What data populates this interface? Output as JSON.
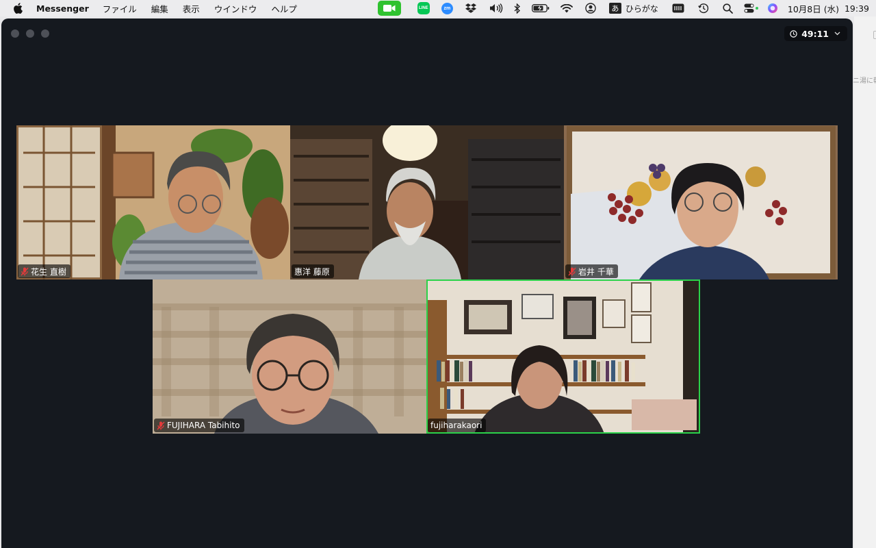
{
  "menubar": {
    "app_name": "Messenger",
    "menus": [
      "ファイル",
      "編集",
      "表示",
      "ウインドウ",
      "ヘルプ"
    ],
    "line_label": "LINE",
    "zoom_label": "zm",
    "ime_char": "あ",
    "ime_label": "ひらがな",
    "date": "10月8日 (水)",
    "time": "19:39"
  },
  "meeting": {
    "elapsed": "49:11"
  },
  "participants": [
    {
      "name": "花生 直樹",
      "muted": true
    },
    {
      "name": "惠洋 藤原",
      "muted": false
    },
    {
      "name": "岩井 千華",
      "muted": true
    },
    {
      "name": "FUJIHARA Tabihito",
      "muted": true
    },
    {
      "name": "fujiharakaori",
      "muted": false,
      "speaking": true
    }
  ],
  "side_window": {
    "text": "ニ湯に朝"
  },
  "colors": {
    "window_bg": "#15191f",
    "active_speaker": "#2bd24a",
    "zoom_green": "#2fc22f"
  }
}
